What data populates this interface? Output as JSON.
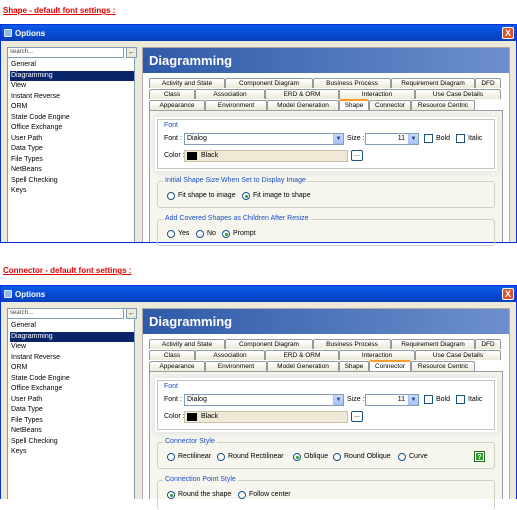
{
  "panels": [
    {
      "caption": "Shape - default font settings :",
      "title": "Options",
      "close": "X",
      "search_placeholder": "search...",
      "search_btn": "←",
      "tree": [
        "General",
        "Diagramming",
        "View",
        "Instant Reverse",
        "ORM",
        "State Code Engine",
        "Office Exchange",
        "User Path",
        "Data Type",
        "File Types",
        "NetBeans",
        "Spell Checking",
        "Keys"
      ],
      "tree_selected": 1,
      "header": "Diagramming",
      "tab_rows": [
        [
          "Activity and State",
          "Component Diagram",
          "Business Process",
          "Requirement Diagram",
          "DFD"
        ],
        [
          "Class",
          "Association",
          "ERD & ORM",
          "Interaction",
          "Use Case Details"
        ],
        [
          "Appearance",
          "Environment",
          "Model Generation",
          "Shape",
          "Connector",
          "Resource Centric"
        ]
      ],
      "active_tab": "Shape",
      "font": {
        "group": "Font",
        "font_label": "Font :",
        "font_value": "Dialog",
        "size_label": "Size :",
        "size_value": "11",
        "bold": "Bold",
        "italic": "Italic",
        "color_label": "Color :",
        "color_value": "Black",
        "browse": "..."
      },
      "group1": {
        "label": "Initial Shape Size When Set to Display Image",
        "options": [
          "Fit shape to image",
          "Fit image to shape"
        ],
        "selected": 1
      },
      "group2": {
        "label": "Add Covered Shapes as Children After Resize",
        "options": [
          "Yes",
          "No",
          "Prompt"
        ],
        "selected": 2
      }
    },
    {
      "caption": "Connector - default font settings :",
      "title": "Options",
      "close": "X",
      "search_placeholder": "search...",
      "search_btn": "←",
      "tree": [
        "General",
        "Diagramming",
        "View",
        "Instant Reverse",
        "ORM",
        "State Code Engine",
        "Office Exchange",
        "User Path",
        "Data Type",
        "File Types",
        "NetBeans",
        "Spell Checking",
        "Keys"
      ],
      "tree_selected": 1,
      "header": "Diagramming",
      "tab_rows": [
        [
          "Activity and State",
          "Component Diagram",
          "Business Process",
          "Requirement Diagram",
          "DFD"
        ],
        [
          "Class",
          "Association",
          "ERD & ORM",
          "Interaction",
          "Use Case Details"
        ],
        [
          "Appearance",
          "Environment",
          "Model Generation",
          "Shape",
          "Connector",
          "Resource Centric"
        ]
      ],
      "active_tab": "Connector",
      "font": {
        "group": "Font",
        "font_label": "Font :",
        "font_value": "Dialog",
        "size_label": "Size :",
        "size_value": "11",
        "bold": "Bold",
        "italic": "Italic",
        "color_label": "Color :",
        "color_value": "Black",
        "browse": "..."
      },
      "group1": {
        "label": "Connector Style",
        "options": [
          "Rectilinear",
          "Round Rectilinear",
          "Oblique",
          "Round Oblique",
          "Curve"
        ],
        "selected": 2,
        "help": "?"
      },
      "group2": {
        "label": "Connection Point Style",
        "options": [
          "Round the shape",
          "Follow center"
        ],
        "selected": 0
      }
    }
  ],
  "colors": {
    "caption": "#e00000",
    "titlebar": "#0848d0",
    "header": "#2f5aa8",
    "selected": "#0a246a",
    "active_tab_accent": "#ff9e2c"
  }
}
